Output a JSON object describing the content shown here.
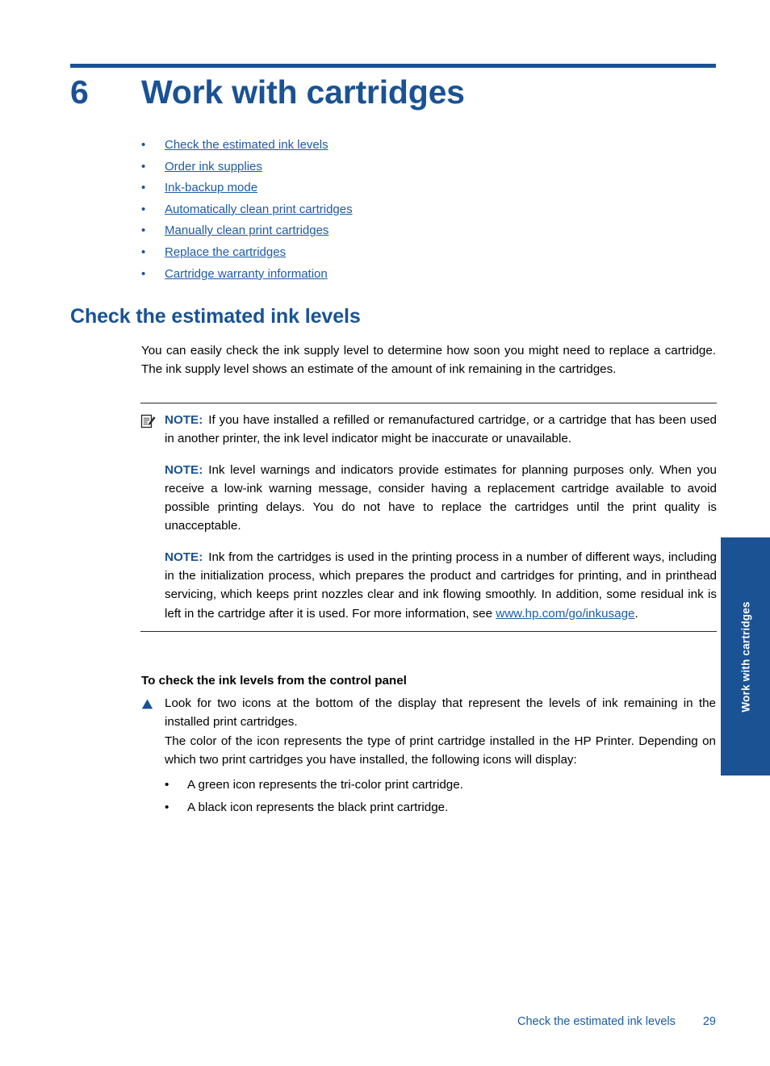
{
  "chapter": {
    "number": "6",
    "title": "Work with cartridges"
  },
  "toc": {
    "bullet": "•",
    "items": [
      {
        "label": "Check the estimated ink levels"
      },
      {
        "label": "Order ink supplies"
      },
      {
        "label": "Ink-backup mode"
      },
      {
        "label": "Automatically clean print cartridges"
      },
      {
        "label": "Manually clean print cartridges"
      },
      {
        "label": "Replace the cartridges"
      },
      {
        "label": "Cartridge warranty information"
      }
    ]
  },
  "section": {
    "heading": "Check the estimated ink levels",
    "intro": "You can easily check the ink supply level to determine how soon you might need to replace a cartridge. The ink supply level shows an estimate of the amount of ink remaining in the cartridges."
  },
  "notes": {
    "label": "NOTE:",
    "items": [
      {
        "text": "If you have installed a refilled or remanufactured cartridge, or a cartridge that has been used in another printer, the ink level indicator might be inaccurate or unavailable."
      },
      {
        "text": "Ink level warnings and indicators provide estimates for planning purposes only. When you receive a low-ink warning message, consider having a replacement cartridge available to avoid possible printing delays. You do not have to replace the cartridges until the print quality is unacceptable."
      },
      {
        "text_before": "Ink from the cartridges is used in the printing process in a number of different ways, including in the initialization process, which prepares the product and cartridges for printing, and in printhead servicing, which keeps print nozzles clear and ink flowing smoothly. In addition, some residual ink is left in the cartridge after it is used. For more information, see ",
        "link": "www.hp.com/go/inkusage",
        "text_after": "."
      }
    ]
  },
  "procedure": {
    "heading": "To check the ink levels from the control panel",
    "step_paragraph_1": "Look for two icons at the bottom of the display that represent the levels of ink remaining in the installed print cartridges.",
    "step_paragraph_2": "The color of the icon represents the type of print cartridge installed in the HP Printer. Depending on which two print cartridges you have installed, the following icons will display:",
    "sub_bullet": "•",
    "sub_items": [
      {
        "label": "A green icon represents the tri-color print cartridge."
      },
      {
        "label": "A black icon represents the black print cartridge."
      }
    ]
  },
  "side_tab": {
    "label": "Work with cartridges"
  },
  "footer": {
    "title": "Check the estimated ink levels",
    "page": "29"
  },
  "colors": {
    "brand_blue": "#1a5293",
    "link_blue": "#1d5ba4",
    "rule_dark": "#2a2a2a"
  }
}
